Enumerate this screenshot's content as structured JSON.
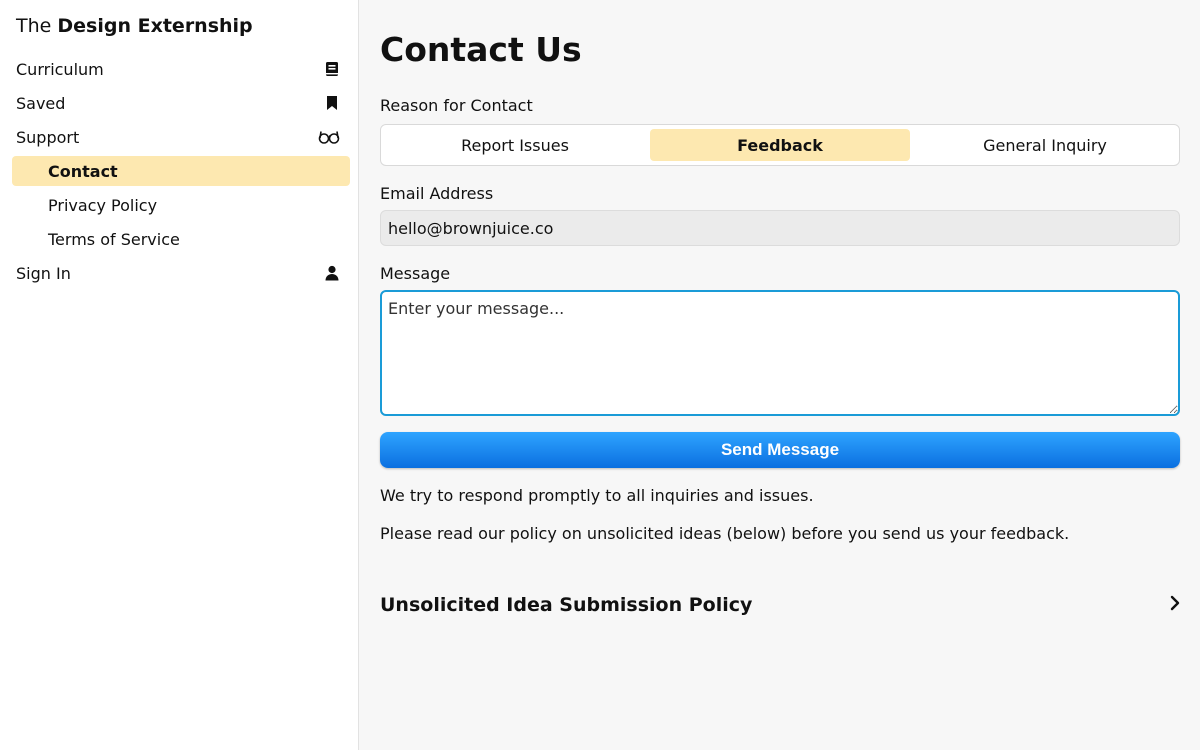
{
  "sidebar": {
    "brand_prefix": "The",
    "brand_name": "Design Externship",
    "items": [
      {
        "label": "Curriculum",
        "icon": "book-icon"
      },
      {
        "label": "Saved",
        "icon": "bookmark-icon"
      },
      {
        "label": "Support",
        "icon": "glasses-icon"
      },
      {
        "label": "Contact",
        "active": true
      },
      {
        "label": "Privacy Policy"
      },
      {
        "label": "Terms of Service"
      },
      {
        "label": "Sign In",
        "icon": "person-icon"
      }
    ]
  },
  "main": {
    "title": "Contact Us",
    "reason_label": "Reason for Contact",
    "reasons": [
      "Report Issues",
      "Feedback",
      "General Inquiry"
    ],
    "selected_reason": "Feedback",
    "email_label": "Email Address",
    "email_value": "hello@brownjuice.co",
    "message_label": "Message",
    "message_placeholder": "Enter your message...",
    "send_label": "Send Message",
    "note1": "We try to respond promptly to all inquiries and issues.",
    "note2": "Please read our policy on unsolicited ideas (below) before you send us your feedback.",
    "policy_title": "Unsolicited Idea Submission Policy",
    "policy_icon": "chevron-right-icon"
  },
  "colors": {
    "accent_highlight": "#fde8b0",
    "button_blue": "#0a6fe0",
    "focus_border": "#1a9bd7"
  }
}
